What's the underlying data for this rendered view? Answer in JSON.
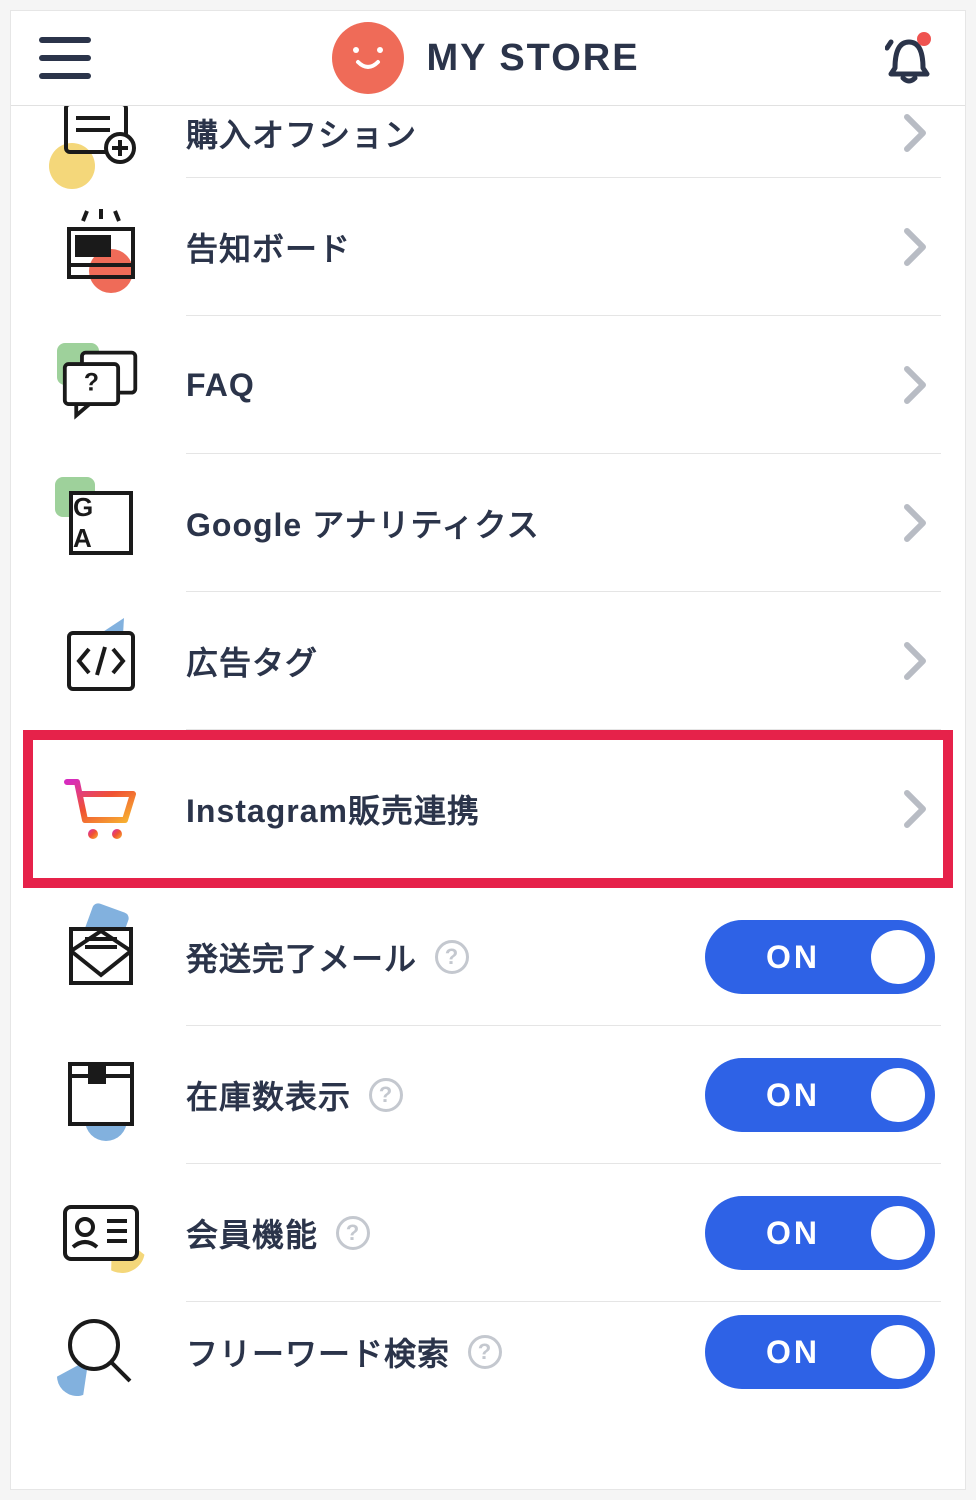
{
  "header": {
    "title": "MY STORE"
  },
  "menu": {
    "items": [
      {
        "id": "purchase-option",
        "label": "購入オフション",
        "type": "nav"
      },
      {
        "id": "notice-board",
        "label": "告知ボード",
        "type": "nav"
      },
      {
        "id": "faq",
        "label": "FAQ",
        "type": "nav"
      },
      {
        "id": "google-analytics",
        "label": "Google アナリティクス",
        "type": "nav"
      },
      {
        "id": "ad-tag",
        "label": "広告タグ",
        "type": "nav"
      },
      {
        "id": "instagram",
        "label": "Instagram販売連携",
        "type": "nav",
        "highlighted": true
      },
      {
        "id": "ship-mail",
        "label": "発送完了メール",
        "type": "toggle",
        "value": "ON",
        "help": true
      },
      {
        "id": "stock",
        "label": "在庫数表示",
        "type": "toggle",
        "value": "ON",
        "help": true
      },
      {
        "id": "member",
        "label": "会員機能",
        "type": "toggle",
        "value": "ON",
        "help": true
      },
      {
        "id": "freeword",
        "label": "フリーワード検索",
        "type": "toggle",
        "value": "ON",
        "help": true
      }
    ]
  },
  "toggle_on_label": "ON",
  "ga_icon_text": "G A"
}
